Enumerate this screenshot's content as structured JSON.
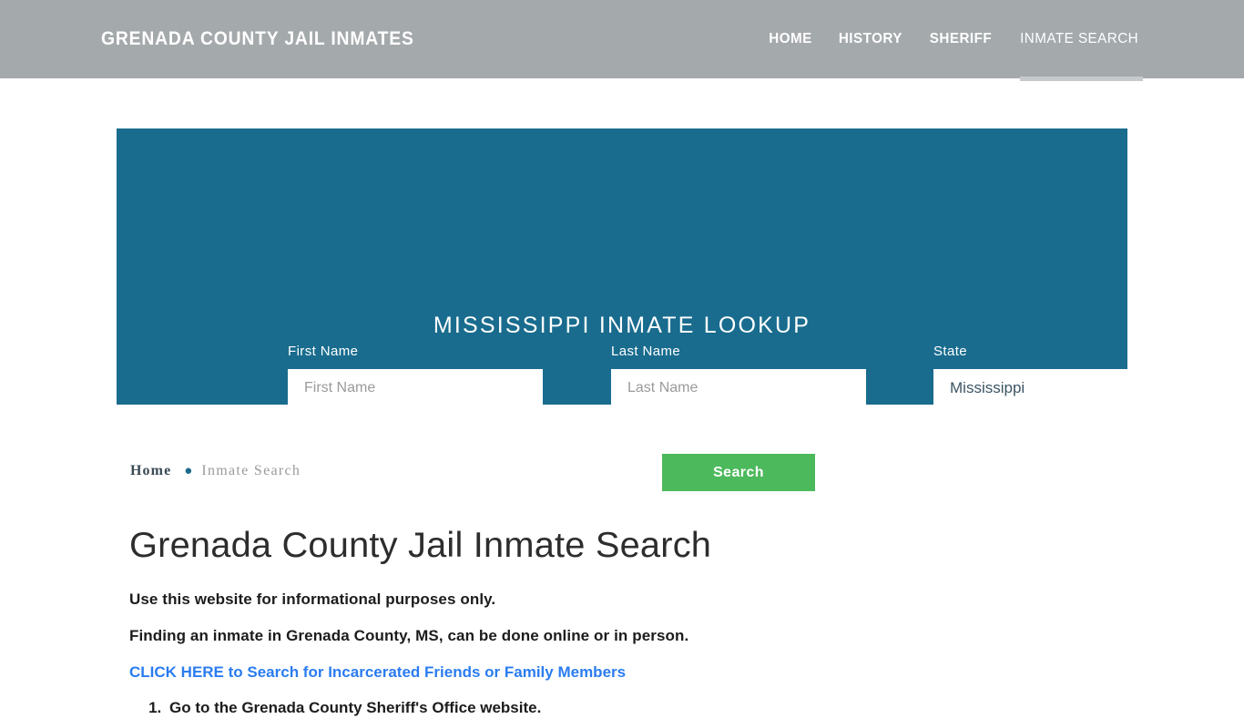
{
  "header": {
    "brand": "GRENADA COUNTY JAIL INMATES",
    "nav": [
      {
        "label": "HOME",
        "active": false
      },
      {
        "label": "HISTORY",
        "active": false
      },
      {
        "label": "SHERIFF",
        "active": false
      },
      {
        "label": "INMATE SEARCH",
        "active": true
      }
    ],
    "background_color": "#a4a9ac",
    "active_bar_color": "#c7cacc"
  },
  "search_panel": {
    "title": "MISSISSIPPI INMATE LOOKUP",
    "background_color": "#196c8e",
    "fields": [
      {
        "label": "First Name",
        "placeholder": "First Name",
        "value": ""
      },
      {
        "label": "Last Name",
        "placeholder": "Last Name",
        "value": ""
      },
      {
        "label": "State",
        "placeholder": "State",
        "value": "Mississippi"
      }
    ],
    "submit_label": "Search",
    "submit_color": "#4cb95c"
  },
  "breadcrumb": {
    "home": "Home",
    "separator": "●",
    "current": "Inmate Search"
  },
  "content": {
    "page_title": "Grenada County Jail Inmate Search",
    "paragraph_1": "Use this website for informational purposes only.",
    "paragraph_2": "Finding an inmate in Grenada County, MS, can be done online or in person.",
    "link_text": "CLICK HERE to Search for Incarcerated Friends or Family Members",
    "link_color": "#2b7cf0",
    "steps": [
      "Go to the Grenada County Sheriff's Office website."
    ]
  }
}
